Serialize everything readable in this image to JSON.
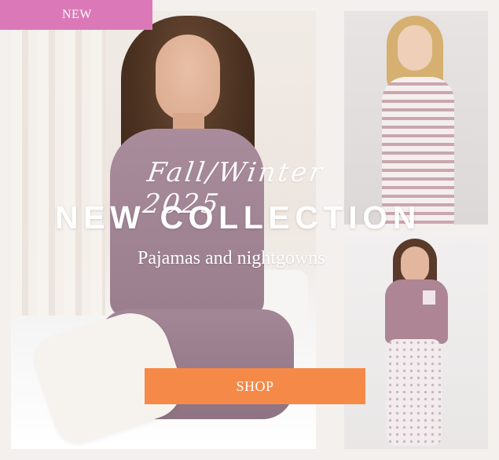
{
  "banner": {
    "badge_label": "NEW",
    "season_text": "Fall/Winter 2025",
    "headline": "NEW COLLECTION",
    "subtitle": "Pajamas and nightgowns",
    "shop_label": "SHOP"
  },
  "colors": {
    "badge": "#db79b8",
    "button": "#f58a48",
    "text": "#ffffff"
  }
}
